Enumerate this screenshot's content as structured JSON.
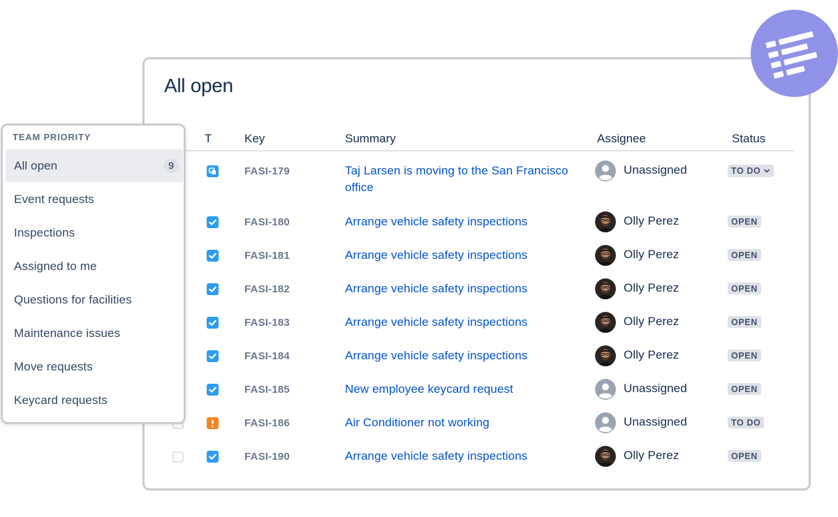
{
  "page": {
    "title": "All open"
  },
  "columns": {
    "type": "T",
    "key": "Key",
    "summary": "Summary",
    "assignee": "Assignee",
    "status": "Status"
  },
  "rows": [
    {
      "type": "service-request",
      "key": "FASI-179",
      "summary": "Taj Larsen is moving to the San Francisco office",
      "assignee": "Unassigned",
      "assignee_avatar": "unassigned",
      "status": "TO DO",
      "status_has_menu": true,
      "checkbox_visible": false
    },
    {
      "type": "task",
      "key": "FASI-180",
      "summary": "Arrange vehicle safety inspections",
      "assignee": "Olly Perez",
      "assignee_avatar": "photo",
      "status": "OPEN",
      "checkbox_visible": false
    },
    {
      "type": "task",
      "key": "FASI-181",
      "summary": "Arrange vehicle safety inspections",
      "assignee": "Olly Perez",
      "assignee_avatar": "photo",
      "status": "OPEN",
      "checkbox_visible": false
    },
    {
      "type": "task",
      "key": "FASI-182",
      "summary": "Arrange vehicle safety inspections",
      "assignee": "Olly Perez",
      "assignee_avatar": "photo",
      "status": "OPEN",
      "checkbox_visible": false
    },
    {
      "type": "task",
      "key": "FASI-183",
      "summary": "Arrange vehicle safety inspections",
      "assignee": "Olly Perez",
      "assignee_avatar": "photo",
      "status": "OPEN",
      "checkbox_visible": false
    },
    {
      "type": "task",
      "key": "FASI-184",
      "summary": "Arrange vehicle safety inspections",
      "assignee": "Olly Perez",
      "assignee_avatar": "photo",
      "status": "OPEN",
      "checkbox_visible": false
    },
    {
      "type": "task",
      "key": "FASI-185",
      "summary": "New employee keycard request",
      "assignee": "Unassigned",
      "assignee_avatar": "unassigned",
      "status": "OPEN",
      "checkbox_visible": false
    },
    {
      "type": "incident",
      "key": "FASI-186",
      "summary": "Air Conditioner not working",
      "assignee": "Unassigned",
      "assignee_avatar": "unassigned",
      "status": "TO DO",
      "checkbox_visible": true
    },
    {
      "type": "task",
      "key": "FASI-190",
      "summary": "Arrange vehicle safety inspections",
      "assignee": "Olly Perez",
      "assignee_avatar": "photo",
      "status": "OPEN",
      "checkbox_visible": true
    }
  ],
  "sidebar": {
    "heading": "TEAM PRIORITY",
    "items": [
      {
        "label": "All open",
        "count": "9",
        "active": true
      },
      {
        "label": "Event requests"
      },
      {
        "label": "Inspections"
      },
      {
        "label": "Assigned to me"
      },
      {
        "label": "Questions for facilities"
      },
      {
        "label": "Maintenance issues"
      },
      {
        "label": "Move requests"
      },
      {
        "label": "Keycard requests"
      }
    ]
  },
  "icons": {
    "queue_badge": "list-icon"
  },
  "colors": {
    "link": "#0052cc",
    "text": "#172b4d",
    "task_icon": "#2d9cf0",
    "incident_icon": "#f5831f",
    "badge": "#8f92e6",
    "status_bg": "#dfe1e6"
  }
}
